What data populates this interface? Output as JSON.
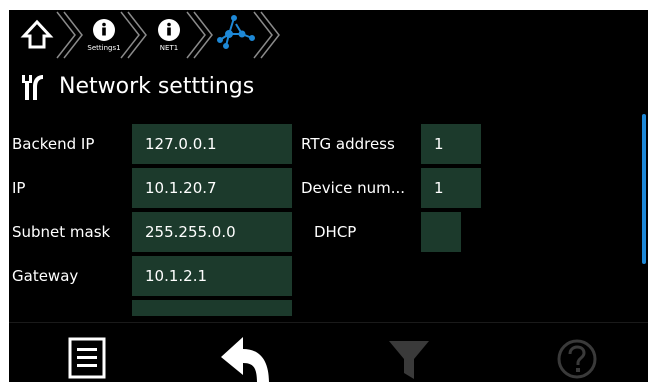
{
  "breadcrumb": {
    "items": [
      {
        "icon": "home-icon",
        "label": ""
      },
      {
        "icon": "info-icon",
        "label": "Settings1"
      },
      {
        "icon": "info-icon",
        "label": "NET1"
      },
      {
        "icon": "network-icon",
        "label": ""
      }
    ]
  },
  "header": {
    "icon": "tools-icon",
    "title": "Network setttings"
  },
  "form": {
    "left": [
      {
        "label": "Backend IP",
        "value": "127.0.0.1"
      },
      {
        "label": "IP",
        "value": "10.1.20.7"
      },
      {
        "label": "Subnet mask",
        "value": "255.255.0.0"
      },
      {
        "label": "Gateway",
        "value": "10.1.2.1"
      }
    ],
    "right": [
      {
        "label": "RTG address",
        "value": "1"
      },
      {
        "label": "Device num...",
        "value": "1"
      },
      {
        "label": "DHCP",
        "value": ""
      }
    ]
  },
  "toolbar": {
    "buttons": [
      {
        "icon": "menu-icon",
        "enabled": true
      },
      {
        "icon": "back-arrow-icon",
        "enabled": true
      },
      {
        "icon": "filter-icon",
        "enabled": false
      },
      {
        "icon": "help-icon",
        "enabled": false
      }
    ]
  },
  "colors": {
    "background": "#000000",
    "field": "#1c3a2c",
    "accent": "#1e88d6",
    "disabled_icon": "#3a3a3a"
  }
}
